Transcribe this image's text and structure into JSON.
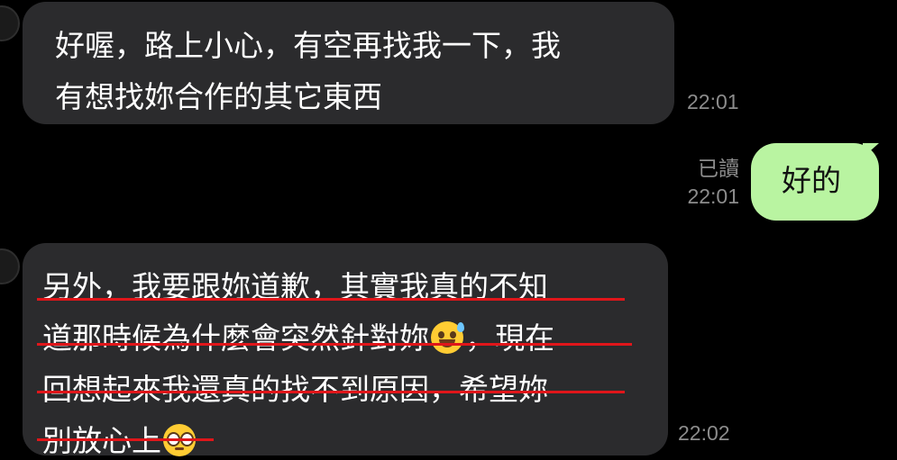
{
  "messages": [
    {
      "side": "left",
      "lines": [
        "好喔，路上小心，有空再找我一下，我",
        "有想找妳合作的其它東西"
      ],
      "time": "22:01"
    },
    {
      "side": "right",
      "text": "好的",
      "read": "已讀",
      "time": "22:01"
    },
    {
      "side": "left",
      "lines": [
        "另外，我要跟妳道歉，其實我真的不知",
        "道那時候為什麼會突然針對妳",
        "，現在",
        "回想起來我還真的找不到原因，希望妳",
        "別放心上"
      ],
      "emoji_1": "grinning-face-with-sweat-icon",
      "emoji_2": "pleading-face-icon",
      "underline_color": "#e0161a",
      "time": "22:02"
    }
  ],
  "colors": {
    "background": "#000000",
    "incoming_bubble": "#2b2b2d",
    "outgoing_bubble": "#b9f4a1",
    "meta_text": "#8c8c8c"
  }
}
